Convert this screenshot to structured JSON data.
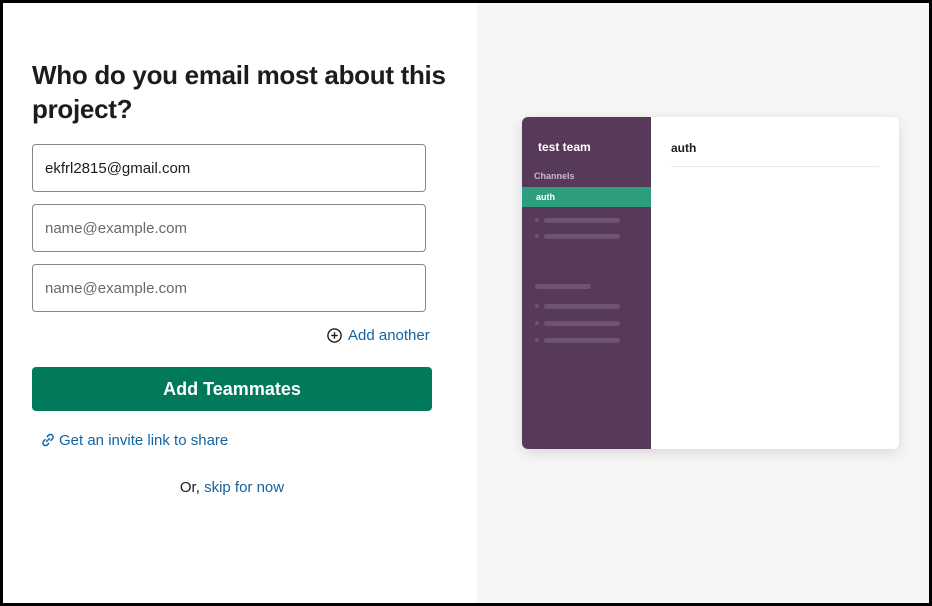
{
  "heading": "Who do you email most about this project?",
  "emails": [
    {
      "value": "ekfrl2815@gmail.com",
      "placeholder": "name@example.com"
    },
    {
      "value": "",
      "placeholder": "name@example.com"
    },
    {
      "value": "",
      "placeholder": "name@example.com"
    }
  ],
  "add_another_label": "Add another",
  "primary_button_label": "Add Teammates",
  "invite_link_label": "Get an invite link to share",
  "skip_prefix": "Or, ",
  "skip_link_label": "skip for now",
  "preview": {
    "team_name": "test team",
    "channels_label": "Channels",
    "active_channel": "auth",
    "channel_title": "auth"
  },
  "icons": {
    "add_another": "plus-circle-icon",
    "invite_link": "link-icon"
  },
  "colors": {
    "primary": "#007a5a",
    "link": "#1264a3",
    "sidebar": "#573a5a",
    "active_channel": "#2d9f7f"
  }
}
